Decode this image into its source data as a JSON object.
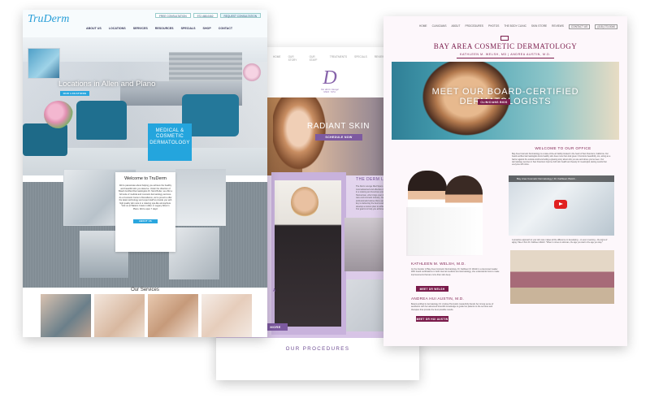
{
  "truderm": {
    "logo": "TruDerm",
    "utility": [
      "FREE CONSULTATION",
      "972-468-0462",
      "REQUEST CONSULTATION"
    ],
    "nav": [
      "ABOUT US",
      "LOCATIONS",
      "SERVICES",
      "RESOURCES",
      "SPECIALS",
      "SHOP",
      "CONTACT"
    ],
    "hero_title": "Locations in Allen and Plano",
    "hero_button": "OUR LOCATIONS",
    "badge": "MEDICAL & COSMETIC DERMATOLOGY",
    "welcome_title": "Welcome to TruDerm",
    "welcome_body": "We're passionate about helping you achieve the healthy and beautiful skin you deserve. Under the direction of Board-Certified Dermatologists Dr. Meni Butler, we offer a full suite of medical and cosmetic dermatology services. As a Cosmetic Center of Excellence, we're proud to offer the latest technology and expert staff to provide you with high quality skin care in a relaxing spa-like atmosphere. Visit us at Watters Creek in Allen or Legacy West in Plano. We're open 7 days!",
    "welcome_button": "ABOUT US",
    "services_title": "Our Services"
  },
  "derm": {
    "nav": [
      "HOME",
      "OUR STORY",
      "OUR STAFF",
      "TREATMENTS",
      "SPECIALS",
      "REVIEWS",
      "SCHEDULE NOW"
    ],
    "logo_letter": "D",
    "logo_name": "the derm lounge",
    "logo_sub": "MED SPA",
    "hero_title": "RADIANT SKIN",
    "hero_button": "SCHEDULE NOW",
    "section_title": "THE DERM LOUNGE",
    "section_body": "The Derm Lounge Med Spa is a boutique spa that provides the most advanced and effective clinical medical aesthetic procedures in a relaxing and luxurious environment. Dana DeLorenzo-Heimerman, who brings over 20 years of experience in the skin care and cosmetic industry. Our team of licensed medical professionals believe that a personal and relaxed approach is the key to delivering the best results possible. We work with you to develop a custom plan to achieve a younger, more refined you. Our goal is to help you achieve a new and remarkable you.",
    "side_text": "A",
    "more_button": "MORE",
    "procedures_title": "OUR PROCEDURES"
  },
  "bay": {
    "nav": [
      "HOME",
      "CLINICIANS",
      "ABOUT",
      "PROCEDURES",
      "PHOTOS",
      "THE BODY CLINIC",
      "SKIN STORE",
      "REVIEWS",
      "CONTACT US",
      "(415) 273-5040"
    ],
    "brand": "BAY AREA COSMETIC DERMATOLOGY",
    "doctors": "KATHLEEN M. WELSH, MD  |  ANDREA AUSTIN, M.D.",
    "hero_title": "MEET OUR BOARD-CERTIFIED DERMATOLOGISTS",
    "hero_button": "CLINICIANS BIOS",
    "doc1_name": "KATHLEEN M. WELSH, M.D.",
    "doc1_body": "As the founder of Bay Area Cosmetic Dermatology, Dr. Kathleen M. Welsh is a top-known leader. With board certifications in both internal medicine and dermatology, she understands how to make improvements that are more than skin deep.",
    "doc1_button": "MEET DR WELSH",
    "doc2_name": "ANDREA HUI AUSTIN, M.D.",
    "doc2_body": "Board-certified in dermatology, Dr. Andrea Hui Austin masterfully blends her strong sense of aesthetics with her advanced scientific knowledge to guide her patients to the services and therapies that provide the best possible results.",
    "doc2_button": "MEET DR HUI AUSTIN",
    "office_title": "WELCOME TO OUR OFFICE",
    "office_body": "Bay Area Cosmetic Dermatology is a state-of-the-art facility located in the heart of San Francisco, California. Our board-certified dermatologists know healthy skin does more than look great. It functions beautifully, too, acting as a barrier against the outside world and telling a glowing story about who you are and where you've been. Our dermatology services in San Francisco improve both skin health and beauty for meaningful, lasting results that everyone will notice.",
    "video_title": "Bay Area Cosmetic Dermatology | Dr. Kathleen Welsh...",
    "office_body2": "A proactive approach to your skin care makes all the difference in developing – or even reversing – the signs of aging. Take it from Dr. Kathleen Welsh: \"When it comes to skincare, the age you start is the age you stay.\""
  }
}
